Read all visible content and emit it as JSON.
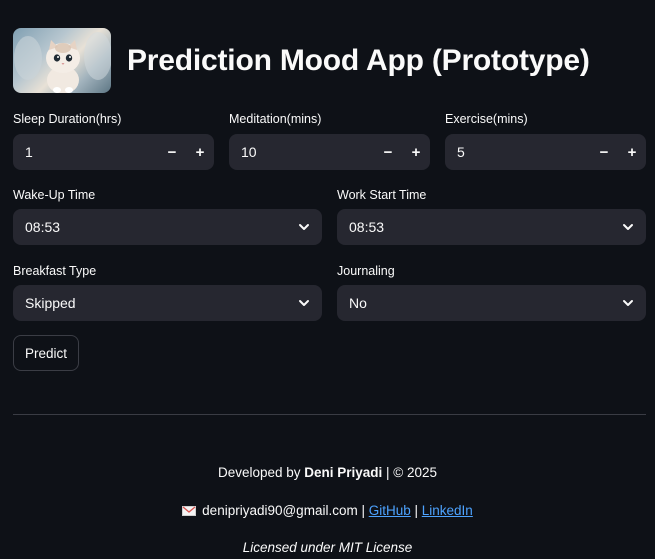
{
  "app": {
    "title": "Prediction Mood App (Prototype)"
  },
  "inputs": {
    "sleep": {
      "label": "Sleep Duration(hrs)",
      "value": "1"
    },
    "meditation": {
      "label": "Meditation(mins)",
      "value": "10"
    },
    "exercise": {
      "label": "Exercise(mins)",
      "value": "5"
    },
    "wake_up": {
      "label": "Wake-Up Time",
      "value": "08:53"
    },
    "work_start": {
      "label": "Work Start Time",
      "value": "08:53"
    },
    "breakfast": {
      "label": "Breakfast Type",
      "value": "Skipped"
    },
    "journaling": {
      "label": "Journaling",
      "value": "No"
    },
    "stepper": {
      "minus": "−",
      "plus": "+"
    }
  },
  "actions": {
    "predict_label": "Predict"
  },
  "footer": {
    "developed_prefix": "Developed by ",
    "developer": "Deni Priyadi",
    "copyright": " | © 2025",
    "email": "denipriyadi90@gmail.com",
    "sep1": " | ",
    "github": "GitHub",
    "sep2": " | ",
    "linkedin": "LinkedIn",
    "license": "Licensed under MIT License"
  },
  "icons": {
    "logo": "kitten-photo",
    "dropdown": "chevron-down-icon",
    "email": "envelope-icon"
  },
  "colors": {
    "background": "#0e1117",
    "input_bg": "#262730",
    "link": "#4da3ff",
    "text": "#fafafa"
  }
}
